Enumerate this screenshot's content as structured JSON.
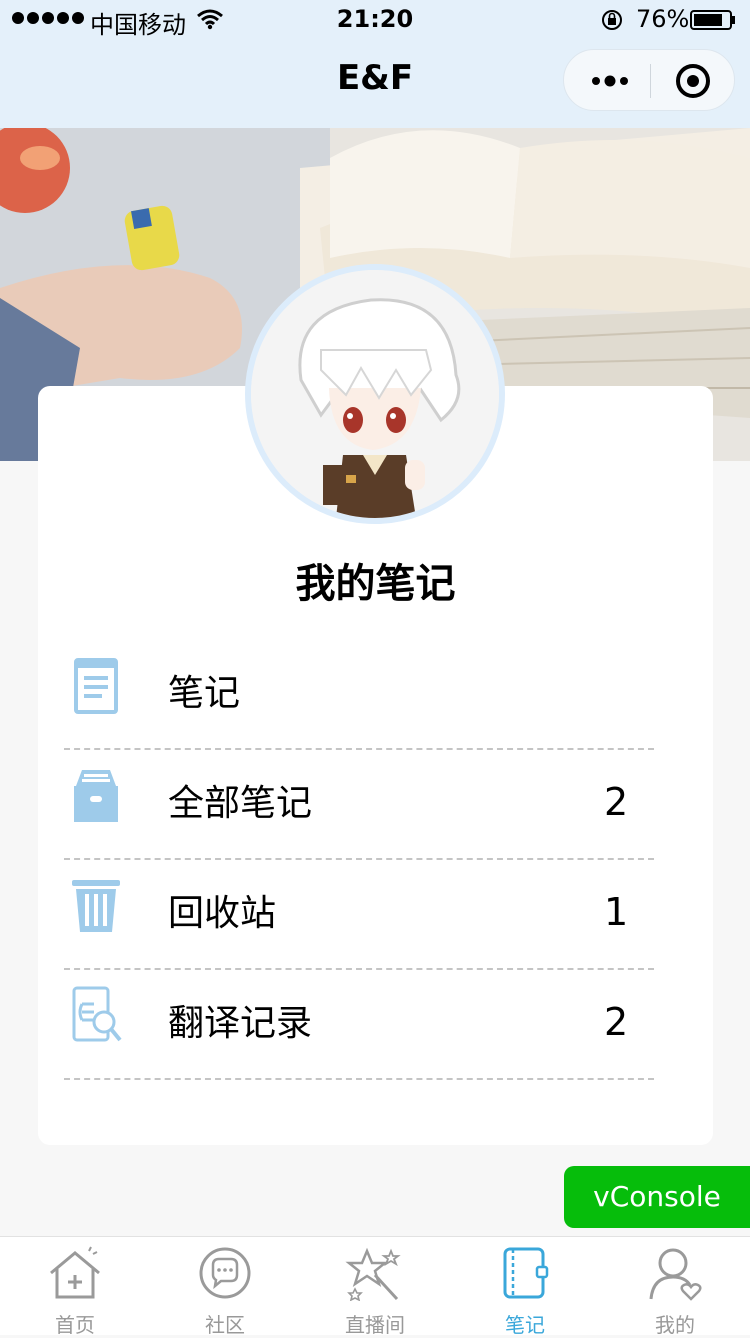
{
  "status_bar": {
    "carrier": "中国移动",
    "time": "21:20",
    "battery": "76%"
  },
  "nav": {
    "title": "E&F"
  },
  "card": {
    "title": "我的笔记",
    "items": [
      {
        "label": "笔记",
        "count": "",
        "icon": "notebook-icon"
      },
      {
        "label": "全部笔记",
        "count": "2",
        "icon": "archive-box-icon"
      },
      {
        "label": "回收站",
        "count": "1",
        "icon": "trash-icon"
      },
      {
        "label": "翻译记录",
        "count": "2",
        "icon": "translate-search-icon"
      }
    ]
  },
  "vconsole": {
    "label": "vConsole"
  },
  "tabbar": {
    "tabs": [
      {
        "label": "首页",
        "icon": "home-icon",
        "active": false
      },
      {
        "label": "社区",
        "icon": "chat-bubble-icon",
        "active": false
      },
      {
        "label": "直播间",
        "icon": "magic-wand-icon",
        "active": false
      },
      {
        "label": "笔记",
        "icon": "notebook-icon",
        "active": true
      },
      {
        "label": "我的",
        "icon": "user-heart-icon",
        "active": false
      }
    ]
  },
  "colors": {
    "accent": "#3aa7da",
    "vconsole": "#06bd0b",
    "nav_bg": "#e4f0fa",
    "icon_blue": "#9ecbea"
  }
}
